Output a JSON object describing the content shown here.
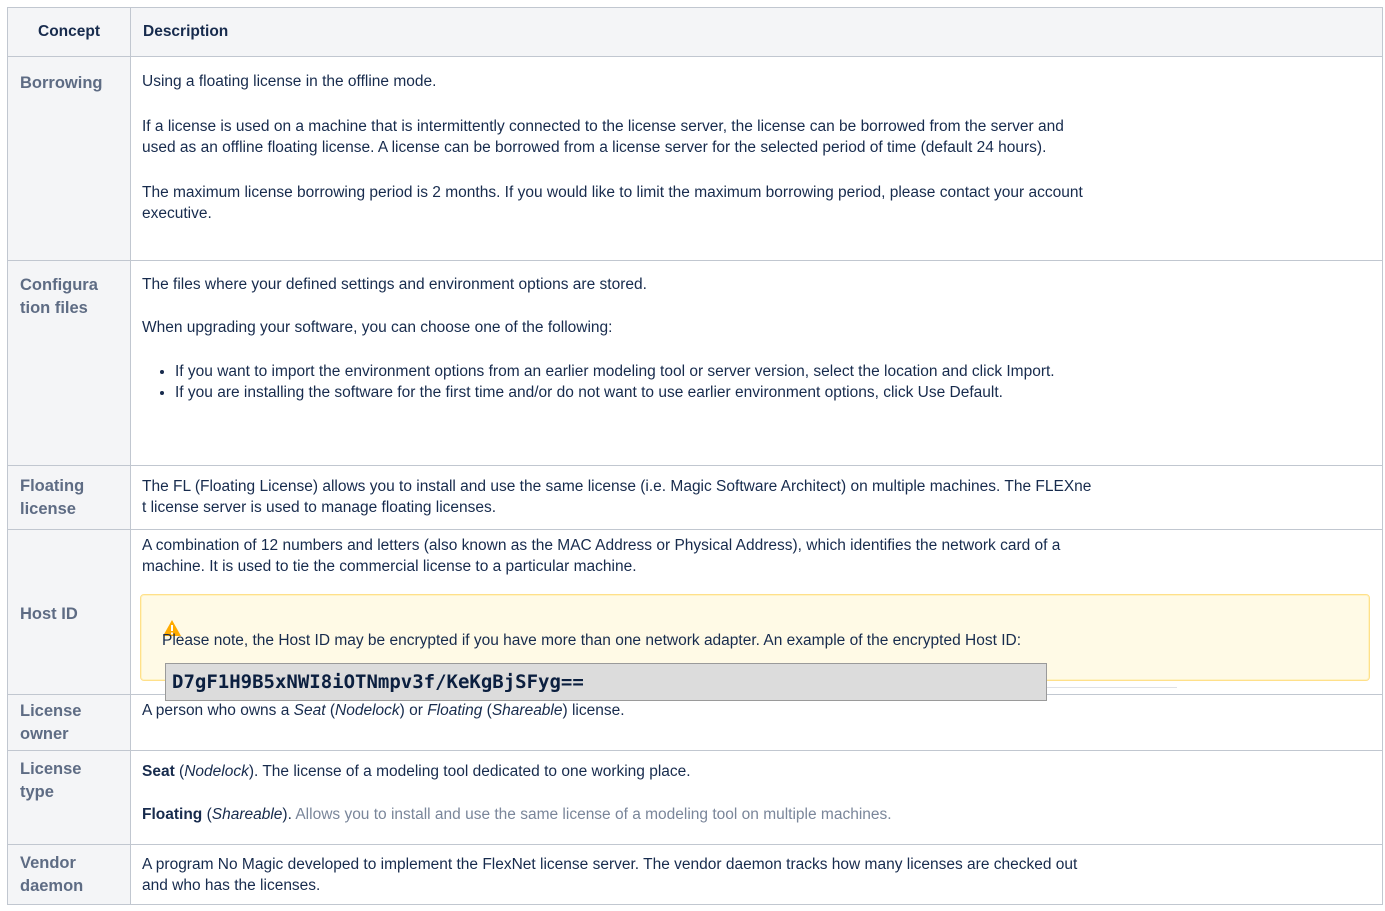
{
  "header": {
    "concept": "Concept",
    "description": "Description"
  },
  "rows": {
    "borrowing": {
      "concept": "Borrowing",
      "p1": "Using a floating license in the offline mode.",
      "p2a": "If a license is used on a machine that is intermittently connected to the license server, the license can be borrowed from the server and",
      "p2b": "used as an offline floating license. A license can be borrowed from a license server for the selected period of time (default 24 hours).",
      "p3a": "The maximum license borrowing period is 2 months. If you would like to limit the maximum borrowing period, please contact your account",
      "p3b": "executive."
    },
    "config": {
      "concept1": "Configura",
      "concept2": "tion files",
      "p1": "The files where your defined settings and environment options are stored.",
      "p2": "When upgrading your software, you can choose one of the following:",
      "b1": "If you want to import the environment options from an earlier modeling tool or server version, select the location and click Import.",
      "b2": "If you are installing the software for the first time and/or do not want to use earlier environment options, click Use Default."
    },
    "floating": {
      "concept1": "Floating",
      "concept2": "license",
      "p1a": "The FL (Floating License) allows you to install and use the same license (i.e. Magic Software Architect) on multiple machines. The FLEXne",
      "p1b": "t license server is used to manage floating licenses."
    },
    "hostid": {
      "concept": "Host ID",
      "p1a": "A combination of 12 numbers and letters (also known as the MAC Address or Physical Address), which identifies the network card of a",
      "p1b": "machine. It is used to tie the commercial license to a particular machine.",
      "note": "Please note, the Host ID may be encrypted if you have more than one network adapter. An example of the encrypted Host ID:",
      "example": "D7gF1H9B5xNWI8iOTNmpv3f/KeKgBjSFyg=="
    },
    "owner": {
      "concept1": "License",
      "concept2": "owner",
      "t1": "A person who owns a ",
      "seat": "Seat",
      "t2": " (",
      "nodelock": "Nodelock",
      "t3": ") or ",
      "floating": "Floating",
      "t4": " (",
      "shareable": "Shareable",
      "t5": ") license."
    },
    "type": {
      "concept1": "License",
      "concept2": "type",
      "seat_bold": "Seat",
      "seat_open": " (",
      "seat_italic": "Nodelock",
      "seat_rest": "). The license of a modeling tool dedicated to one working place.",
      "float_bold": "Floating",
      "float_open": " (",
      "float_italic": "Shareable",
      "float_close": "). ",
      "float_rest": "Allows you to install and use the same license of a modeling tool on multiple machines."
    },
    "vendor": {
      "concept1": "Vendor",
      "concept2": "daemon",
      "p1a": "A program No Magic developed to implement the FlexNet license server. The vendor daemon tracks how many licenses are checked out",
      "p1b": "and who has the licenses."
    }
  },
  "colors": {
    "border": "#c1c7d0",
    "concept_text": "#5e6c84",
    "header_bg": "#f4f5f7",
    "note_bg": "#fffae6",
    "warning": "#ffab00"
  },
  "icons": {
    "note": "warning-icon"
  }
}
